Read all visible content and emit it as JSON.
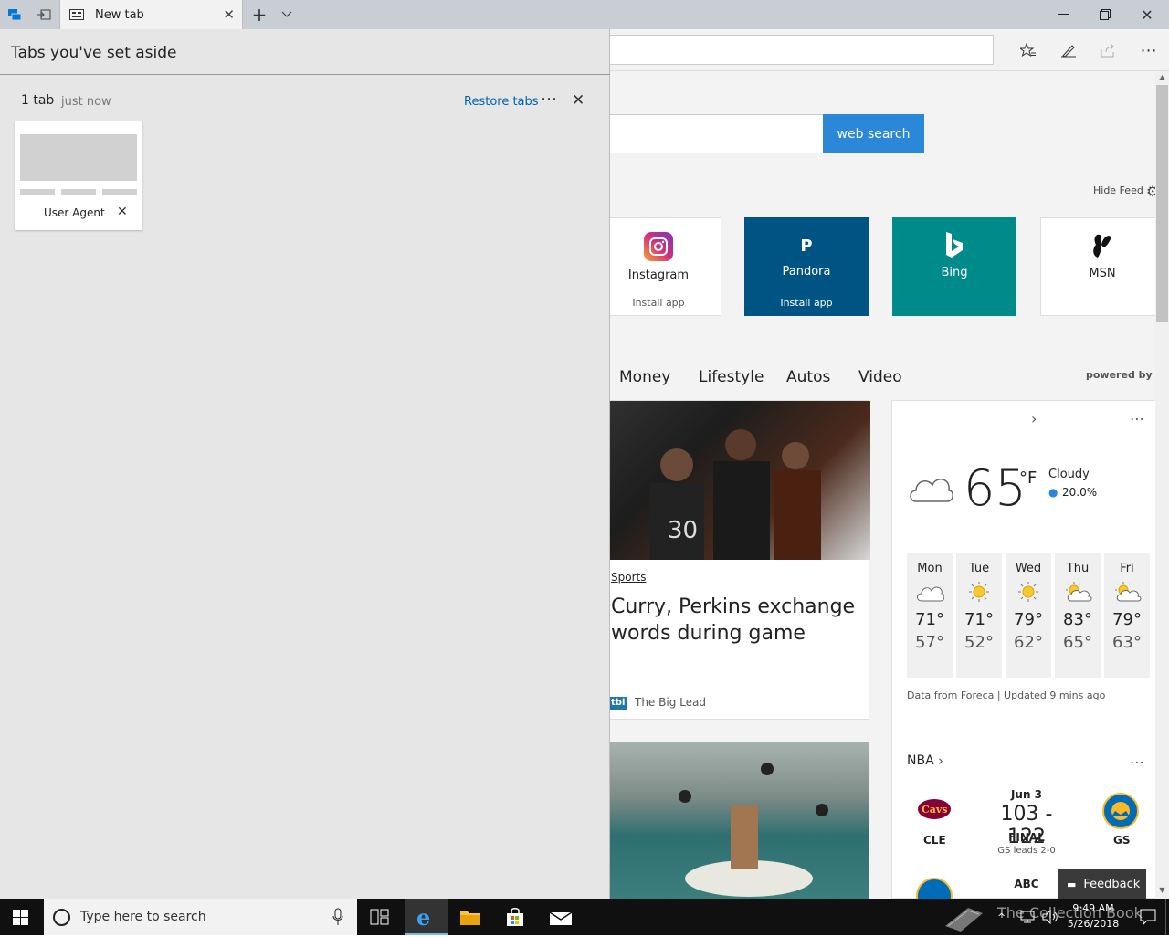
{
  "tabbar": {
    "tab_title": "New tab"
  },
  "aside_panel": {
    "title": "Tabs you've set aside",
    "group_count": "1 tab",
    "group_time": "just now",
    "restore_label": "Restore tabs",
    "tab_card_label": "User Agent"
  },
  "search": {
    "button_label": "web search"
  },
  "feed": {
    "hide_label": "Hide Feed",
    "powered_by": "powered by MS"
  },
  "tiles": [
    {
      "name": "Instagram",
      "sub": "Install app",
      "bg": "#ffffff"
    },
    {
      "name": "Pandora",
      "sub": "Install app",
      "bg": "#005483"
    },
    {
      "name": "Bing",
      "sub": "",
      "bg": "#008b8b"
    },
    {
      "name": "MSN",
      "sub": "",
      "bg": "#ffffff"
    }
  ],
  "nav": [
    "Money",
    "Lifestyle",
    "Autos",
    "Video"
  ],
  "article": {
    "category": "Sports",
    "headline_1": "Curry, Perkins exchange",
    "headline_2": "words during game",
    "source_logo": "tbl",
    "source": "The Big Lead"
  },
  "weather": {
    "temp": "65",
    "unit": "°F",
    "condition": "Cloudy",
    "precip": "20.0%",
    "days": [
      {
        "day": "Mon",
        "hi": "71°",
        "lo": "57°",
        "icon": "cloud-icon"
      },
      {
        "day": "Tue",
        "hi": "71°",
        "lo": "52°",
        "icon": "sun-icon"
      },
      {
        "day": "Wed",
        "hi": "79°",
        "lo": "62°",
        "icon": "sun-icon"
      },
      {
        "day": "Thu",
        "hi": "83°",
        "lo": "65°",
        "icon": "partly-cloudy-icon"
      },
      {
        "day": "Fri",
        "hi": "79°",
        "lo": "63°",
        "icon": "partly-cloudy-icon"
      }
    ],
    "footer": "Data from Foreca | Updated 9 mins ago"
  },
  "nba": {
    "title": "NBA",
    "date": "Jun 3",
    "score": "103 - 122",
    "status": "FINAL",
    "series": "GS leads 2-0",
    "home": "CLE",
    "away": "GS",
    "next_network": "ABC"
  },
  "feedback": {
    "label": "Feedback"
  },
  "taskbar": {
    "search_placeholder": "Type here to search",
    "time": "9:49 AM",
    "date": "5/26/2018",
    "watermark": "The Collection Book"
  },
  "colors": {
    "accent": "#2b88d8",
    "link": "#0063b1",
    "pandora": "#005483",
    "bing": "#008b8b"
  }
}
